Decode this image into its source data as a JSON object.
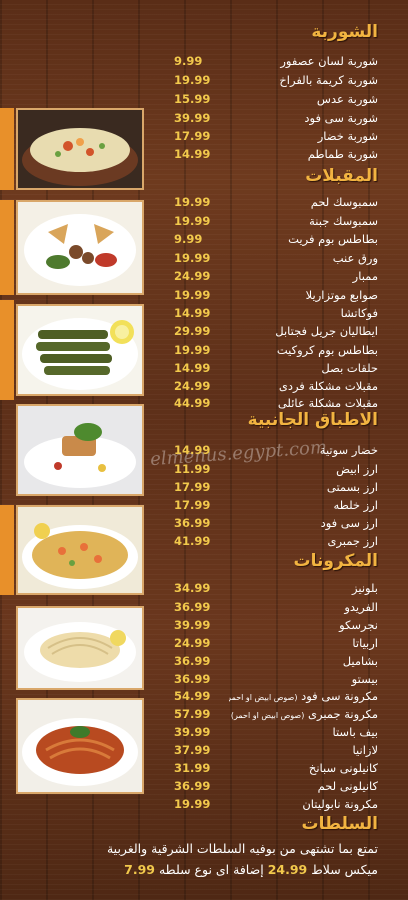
{
  "sections": [
    {
      "title": "الشوربة",
      "items": [
        {
          "name": "شوربة لسان عصفور",
          "price": "9.99"
        },
        {
          "name": "شوربة كريمة بالفراخ",
          "price": "19.99"
        },
        {
          "name": "شوربة عدس",
          "price": "15.99"
        },
        {
          "name": "شوربة سى فود",
          "price": "39.99"
        },
        {
          "name": "شوربة خضار",
          "price": "17.99"
        },
        {
          "name": "شوربة طماطم",
          "price": "14.99"
        }
      ]
    },
    {
      "title": "المقبلات",
      "items": [
        {
          "name": "سمبوسك لحم",
          "price": "19.99"
        },
        {
          "name": "سمبوسك جبنة",
          "price": "19.99"
        },
        {
          "name": "بطاطس بوم فريت",
          "price": "9.99"
        },
        {
          "name": "ورق عنب",
          "price": "19.99"
        },
        {
          "name": "ممبار",
          "price": "24.99"
        },
        {
          "name": "صوابع موتزاريلا",
          "price": "19.99"
        },
        {
          "name": "فوكاتشا",
          "price": "14.99"
        },
        {
          "name": "ايطاليان جريل فجتابل",
          "price": "29.99"
        },
        {
          "name": "بطاطس بوم كروكيت",
          "price": "19.99"
        },
        {
          "name": "حلقات بصل",
          "price": "14.99"
        },
        {
          "name": "مقبلات مشكلة فردى",
          "price": "24.99"
        },
        {
          "name": "مقبلات مشكلة عائلى",
          "price": "44.99"
        }
      ]
    },
    {
      "title": "الاطباق الجانبية",
      "items": [
        {
          "name": "خضار سوتية",
          "price": "14.99"
        },
        {
          "name": "ارز ابيض",
          "price": "11.99"
        },
        {
          "name": "ارز بسمتى",
          "price": "17.99"
        },
        {
          "name": "ارز خلطه",
          "price": "17.99"
        },
        {
          "name": "ارز سى فود",
          "price": "36.99"
        },
        {
          "name": "ارز جمبرى",
          "price": "41.99"
        }
      ]
    },
    {
      "title": "المكرونات",
      "items": [
        {
          "name": "بلونيز",
          "price": "34.99"
        },
        {
          "name": "الفريدو",
          "price": "36.99"
        },
        {
          "name": "نجرسكو",
          "price": "39.99"
        },
        {
          "name": "اربياتا",
          "price": "24.99"
        },
        {
          "name": "بشاميل",
          "price": "36.99"
        },
        {
          "name": "بيستو",
          "price": "36.99"
        },
        {
          "name": "مكرونة سى فود",
          "note": "(صوص ابيض او احمر)",
          "price": "54.99"
        },
        {
          "name": "مكرونة جمبرى",
          "note": "(صوص ابيض او احمر)",
          "price": "57.99"
        },
        {
          "name": "بيف باستا",
          "price": "39.99"
        },
        {
          "name": "لازانيا",
          "price": "37.99"
        },
        {
          "name": "كانيلونى سبانخ",
          "price": "31.99"
        },
        {
          "name": "كانيلونى لحم",
          "price": "36.99"
        },
        {
          "name": "مكرونة نابوليتان",
          "price": "19.99"
        }
      ]
    }
  ],
  "salads": {
    "title": "السلطات",
    "line1": "تمتع بما تشتهى من بوفيه السلطات الشرقية والغربية",
    "line2_text1": "ميكس سلاط",
    "line2_price1": "24.99",
    "line2_text2": "إضافة اى نوع سلطه",
    "line2_price2": "7.99"
  },
  "watermark": "elmenus.egypt.com"
}
